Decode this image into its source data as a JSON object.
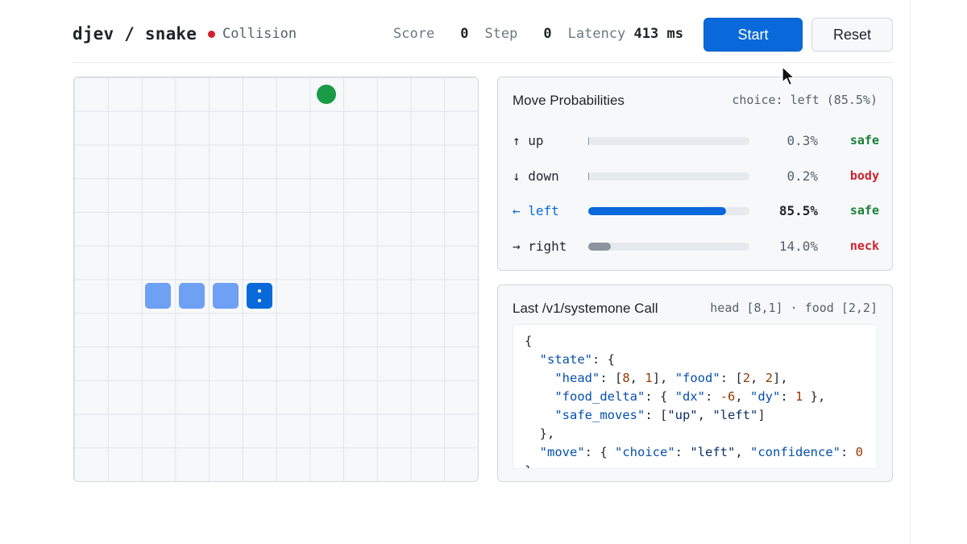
{
  "header": {
    "brand": "djev / snake",
    "status": "Collision",
    "score_label": "Score",
    "score_value": "0",
    "step_label": "Step",
    "step_value": "0",
    "latency_label": "Latency",
    "latency_value": "413 ms",
    "start_label": "Start",
    "reset_label": "Reset"
  },
  "board": {
    "grid_size": 12,
    "snake": [
      [
        2,
        6
      ],
      [
        3,
        6
      ],
      [
        4,
        6
      ],
      [
        5,
        6
      ]
    ],
    "head_index": 3,
    "food": [
      7,
      0
    ]
  },
  "probabilities": {
    "title": "Move Probabilities",
    "choice_text": "choice: left (85.5%)",
    "rows": [
      {
        "label": "↑ up",
        "percent": "0.3%",
        "value": 0.003,
        "tag": "safe",
        "tag_status": "ok",
        "selected": false
      },
      {
        "label": "↓ down",
        "percent": "0.2%",
        "value": 0.002,
        "tag": "body",
        "tag_status": "bad",
        "selected": false
      },
      {
        "label": "← left",
        "percent": "85.5%",
        "value": 0.855,
        "tag": "safe",
        "tag_status": "ok",
        "selected": true
      },
      {
        "label": "→ right",
        "percent": "14.0%",
        "value": 0.14,
        "tag": "neck",
        "tag_status": "bad",
        "selected": false
      }
    ]
  },
  "last_call": {
    "title": "Last /v1/systemone Call",
    "meta": "head [8,1] · food [2,2]",
    "code_lines": [
      "{",
      "  \"state\": {",
      "    \"head\": [8, 1], \"food\": [2, 2],",
      "    \"food_delta\": { \"dx\": -6, \"dy\": 1 },",
      "    \"safe_moves\": [\"up\", \"left\"]",
      "  },",
      "  \"move\": { \"choice\": \"left\", \"confidence\": 0",
      "}"
    ]
  },
  "colors": {
    "accent": "#0969da",
    "snake_body": "#6ea0f4",
    "food": "#1a9c46",
    "danger": "#cf222e",
    "safe": "#1a7f37"
  }
}
